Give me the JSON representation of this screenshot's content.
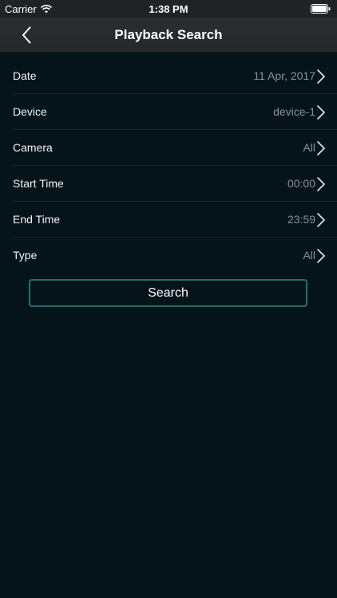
{
  "status_bar": {
    "carrier": "Carrier",
    "time": "1:38 PM",
    "icons": [
      "wifi-icon",
      "battery-icon"
    ]
  },
  "nav": {
    "title": "Playback Search",
    "back_icon": "chevron-left-icon"
  },
  "rows": [
    {
      "label": "Date",
      "value": "11 Apr, 2017"
    },
    {
      "label": "Device",
      "value": "device-1"
    },
    {
      "label": "Camera",
      "value": "All"
    },
    {
      "label": "Start Time",
      "value": "00:00"
    },
    {
      "label": "End Time",
      "value": "23:59"
    },
    {
      "label": "Type",
      "value": "All"
    }
  ],
  "search_button": {
    "label": "Search"
  },
  "colors": {
    "background": "#05141a",
    "navbar": "#2b2e31",
    "accent_border": "#1f6f74",
    "value_text": "#8b9297"
  }
}
